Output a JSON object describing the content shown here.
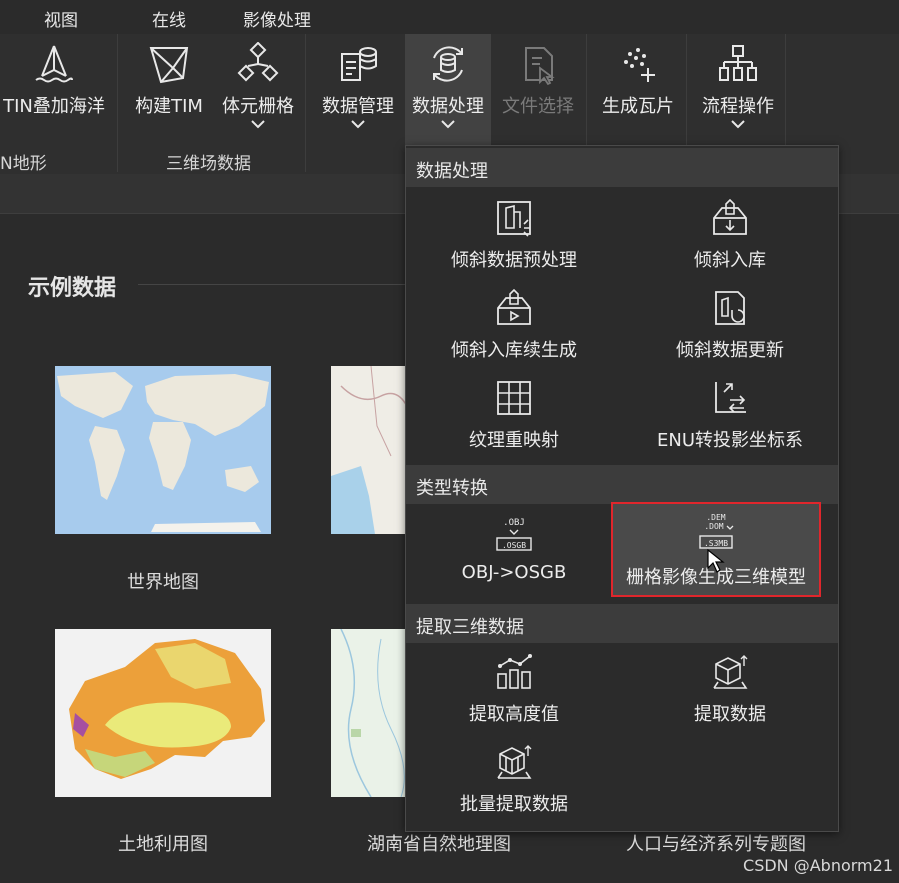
{
  "menu": {
    "view": "视图",
    "online": "在线",
    "image_processing": "影像处理"
  },
  "ribbon": {
    "tin_overlay_label": "TIN叠加海洋",
    "build_tim_label": "构建TIM",
    "voxel_grid_label": "体元栅格",
    "data_management_label": "数据管理",
    "data_processing_label": "数据处理",
    "file_select_label": "文件选择",
    "generate_tiles_label": "生成瓦片",
    "workflow_label": "流程操作",
    "group_tin_terrain": "N地形",
    "group_3d_field": "三维场数据"
  },
  "content": {
    "section_title": "示例数据",
    "thumbnails": [
      {
        "caption": "世界地图"
      },
      {
        "caption": ""
      },
      {
        "caption": "土地利用图"
      },
      {
        "caption": "湖南省自然地理图"
      },
      {
        "caption": "人口与经济系列专题图"
      }
    ]
  },
  "dropdown": {
    "section1": {
      "title": "数据处理",
      "items": [
        {
          "label": "倾斜数据预处理",
          "icon": "oblique-preprocess-icon"
        },
        {
          "label": "倾斜入库",
          "icon": "oblique-import-icon"
        },
        {
          "label": "倾斜入库续生成",
          "icon": "oblique-continue-icon"
        },
        {
          "label": "倾斜数据更新",
          "icon": "oblique-update-icon"
        },
        {
          "label": "纹理重映射",
          "icon": "texture-remap-icon"
        },
        {
          "label": "ENU转投影坐标系",
          "icon": "enu-projection-icon"
        }
      ]
    },
    "section2": {
      "title": "类型转换",
      "items": [
        {
          "label": "OBJ->OSGB",
          "icon_top": ".OBJ",
          "icon_bottom": ".OSGB"
        },
        {
          "label": "栅格影像生成三维模型",
          "icon_top1": ".DEM",
          "icon_top2": ".DOM",
          "icon_bottom": ".S3MB"
        }
      ]
    },
    "section3": {
      "title": "提取三维数据",
      "items": [
        {
          "label": "提取高度值",
          "icon": "extract-height-icon"
        },
        {
          "label": "提取数据",
          "icon": "extract-data-icon"
        },
        {
          "label": "批量提取数据",
          "icon": "batch-extract-icon"
        }
      ]
    }
  },
  "watermark": "CSDN @Abnorm21",
  "colors": {
    "background": "#2b2b2b",
    "ribbon": "#2f2f2f",
    "active_tab": "#424242",
    "selection_border": "#e0262c",
    "header_bg": "#3c3c3c"
  }
}
